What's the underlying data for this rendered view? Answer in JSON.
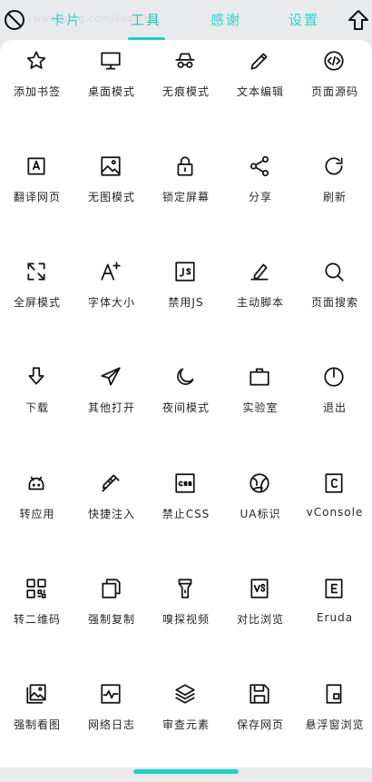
{
  "header": {
    "url_hint": "www.bing.com/search",
    "tabs": [
      "卡片",
      "工具",
      "感谢",
      "设置"
    ],
    "active_tab": "工具",
    "left_icon": "block-icon",
    "right_icon": "up-arrow-icon"
  },
  "accent_color": "#1ccac4",
  "tools": [
    {
      "label": "添加书签",
      "icon": "star"
    },
    {
      "label": "桌面模式",
      "icon": "desktop"
    },
    {
      "label": "无痕模式",
      "icon": "incognito"
    },
    {
      "label": "文本编辑",
      "icon": "pencil"
    },
    {
      "label": "页面源码",
      "icon": "code"
    },
    {
      "label": "翻译网页",
      "icon": "translate"
    },
    {
      "label": "无图模式",
      "icon": "image"
    },
    {
      "label": "锁定屏幕",
      "icon": "lock"
    },
    {
      "label": "分享",
      "icon": "share"
    },
    {
      "label": "刷新",
      "icon": "refresh"
    },
    {
      "label": "全屏模式",
      "icon": "fullscreen"
    },
    {
      "label": "字体大小",
      "icon": "font-size"
    },
    {
      "label": "禁用JS",
      "icon": "js"
    },
    {
      "label": "主动脚本",
      "icon": "script"
    },
    {
      "label": "页面搜索",
      "icon": "search"
    },
    {
      "label": "下载",
      "icon": "download"
    },
    {
      "label": "其他打开",
      "icon": "send"
    },
    {
      "label": "夜间模式",
      "icon": "moon"
    },
    {
      "label": "实验室",
      "icon": "briefcase"
    },
    {
      "label": "退出",
      "icon": "power"
    },
    {
      "label": "转应用",
      "icon": "android"
    },
    {
      "label": "快捷注入",
      "icon": "syringe"
    },
    {
      "label": "禁止CSS",
      "icon": "css"
    },
    {
      "label": "UA标识",
      "icon": "globe"
    },
    {
      "label": "vConsole",
      "icon": "console"
    },
    {
      "label": "转二维码",
      "icon": "qrcode"
    },
    {
      "label": "强制复制",
      "icon": "copy"
    },
    {
      "label": "嗅探视频",
      "icon": "flashlight"
    },
    {
      "label": "对比浏览",
      "icon": "vs"
    },
    {
      "label": "Eruda",
      "icon": "eruda"
    },
    {
      "label": "强制看图",
      "icon": "gallery"
    },
    {
      "label": "网络日志",
      "icon": "pulse"
    },
    {
      "label": "审查元素",
      "icon": "layers"
    },
    {
      "label": "保存网页",
      "icon": "save"
    },
    {
      "label": "悬浮窗浏览",
      "icon": "float-window"
    }
  ]
}
